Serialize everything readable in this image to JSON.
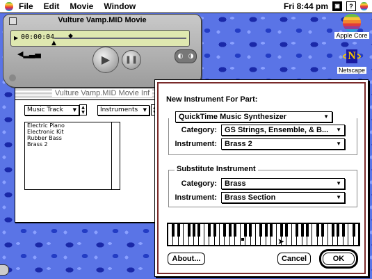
{
  "menubar": {
    "items": [
      "File",
      "Edit",
      "Movie",
      "Window"
    ],
    "clock": "Fri 8:44 pm"
  },
  "player": {
    "title": "Vulture Vamp.MID Movie",
    "time": "00:00:04"
  },
  "desktop_icons": [
    {
      "label": "Apple Core"
    },
    {
      "label": "Netscape"
    }
  ],
  "info_window": {
    "title": "Vulture Vamp.MID Movie Inf",
    "track_popup": "Music Track",
    "info_popup": "Instruments",
    "instruments": [
      "Electric Piano",
      "Electronic Kit",
      "Rubber Bass",
      "Brass 2"
    ]
  },
  "dialog": {
    "heading": "New Instrument For Part:",
    "synth": "QuickTime Music Synthesizer",
    "category_label": "Category:",
    "instrument_label": "Instrument:",
    "category_value": "GS Strings, Ensemble, & B...",
    "instrument_value": "Brass 2",
    "substitute_title": "Substitute Instrument",
    "sub_category_value": "Brass",
    "sub_instrument_value": "Brass Section",
    "about_button": "About...",
    "cancel_button": "Cancel",
    "ok_button": "OK"
  }
}
